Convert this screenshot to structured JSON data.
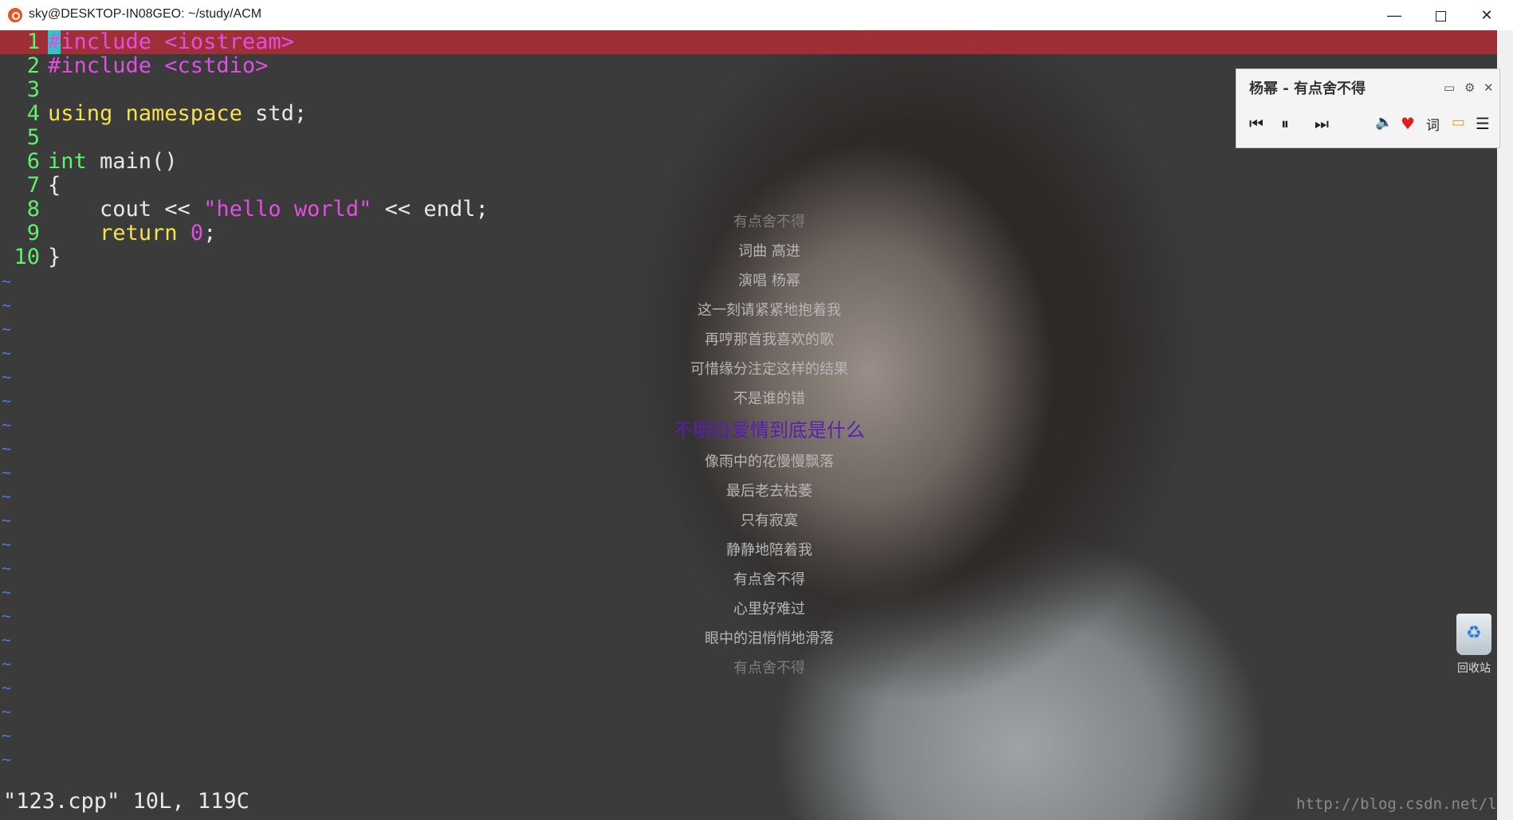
{
  "window": {
    "title": "sky@DESKTOP-IN08GEO: ~/study/ACM",
    "minimize_glyph": "—",
    "close_glyph": "✕"
  },
  "editor": {
    "line_numbers": [
      "1",
      "2",
      "3",
      "4",
      "5",
      "6",
      "7",
      "8",
      "9",
      "10"
    ],
    "lines": {
      "l1_hash": "#",
      "l1_rest": "include <iostream>",
      "l2": "#include <cstdio>",
      "l4_kw": "using namespace",
      "l4_rest": " std;",
      "l6_type": "int",
      "l6_rest": " main()",
      "l7": "{",
      "l8_pre": "    cout << ",
      "l8_str": "\"hello world\"",
      "l8_post": " << endl;",
      "l9_kw": "    return",
      "l9_num": " 0",
      "l9_post": ";",
      "l10": "}"
    },
    "empty_line_marker": "~",
    "status_line": "\"123.cpp\" 10L, 119C",
    "watermark": "http://blog.csdn.net/lcuw"
  },
  "player": {
    "song_title": "杨幂 - 有点舍不得",
    "lyric_button": "词",
    "icons": [
      "mini-mode-icon",
      "settings-icon",
      "close-icon",
      "previous-icon",
      "pause-icon",
      "next-icon",
      "volume-icon",
      "heart-icon",
      "tv-icon",
      "playlist-icon"
    ]
  },
  "lyrics": {
    "lines": [
      "有点舍不得",
      "词曲 高进",
      "演唱 杨幂",
      "这一刻请紧紧地抱着我",
      "再哼那首我喜欢的歌",
      "可惜缘分注定这样的结果",
      "不是谁的错",
      "不明白爱情到底是什么",
      "像雨中的花慢慢飘落",
      "最后老去枯萎",
      "只有寂寞",
      "静静地陪着我",
      "有点舍不得",
      "心里好难过",
      "眼中的泪悄悄地滑落",
      "有点舍不得"
    ],
    "current_index": 7
  },
  "desktop": {
    "recycle_bin_label": "回收站"
  },
  "colors": {
    "highlight_line": "#a42e36",
    "line_number": "#5ef16a",
    "preprocessor": "#e24ee2",
    "keyword_type": "#5ef16a",
    "keyword_return": "#f5e24d",
    "tilde": "#4a78d8",
    "current_lyric": "#5a1eb4",
    "heart": "#e02020"
  }
}
